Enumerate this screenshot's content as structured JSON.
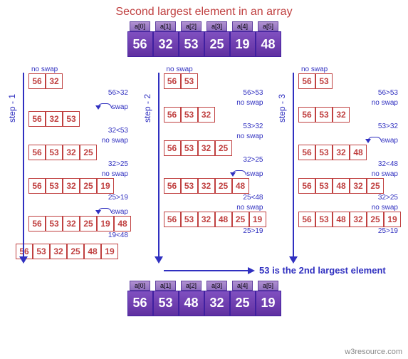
{
  "title": "Second largest element in an array",
  "top_array": {
    "indices": [
      "a[0]",
      "a[1]",
      "a[2]",
      "a[3]",
      "a[4]",
      "a[5]"
    ],
    "values": [
      "56",
      "32",
      "53",
      "25",
      "19",
      "48"
    ]
  },
  "bottom_array": {
    "indices": [
      "a[0]",
      "a[1]",
      "a[2]",
      "a[3]",
      "a[4]",
      "a[5]"
    ],
    "values": [
      "56",
      "53",
      "48",
      "32",
      "25",
      "19"
    ]
  },
  "result_text": "53 is the 2nd largest element",
  "watermark": "w3resource.com",
  "labels": {
    "no_swap": "no swap",
    "swap": "swap"
  },
  "steps": [
    {
      "label": "step - 1",
      "rows": [
        {
          "top": "no swap",
          "top_align": "left",
          "cells": [
            "56",
            "32"
          ],
          "bot": "56>32"
        },
        {
          "top": "swap",
          "top_align": "right",
          "cells": [
            "56",
            "32",
            "53"
          ],
          "bot": "32<53",
          "swap_arc": true
        },
        {
          "top": "no swap",
          "top_align": "right",
          "cells": [
            "56",
            "53",
            "32",
            "25"
          ],
          "bot": "32>25"
        },
        {
          "top": "no swap",
          "top_align": "right",
          "cells": [
            "56",
            "53",
            "32",
            "25",
            "19"
          ],
          "bot": "25>19"
        },
        {
          "top": "swap",
          "top_align": "right",
          "cells": [
            "56",
            "53",
            "32",
            "25",
            "19",
            "48"
          ],
          "bot": "19<48",
          "swap_arc": true
        }
      ],
      "extra_row": [
        "56",
        "53",
        "32",
        "25",
        "48",
        "19"
      ]
    },
    {
      "label": "step - 2",
      "rows": [
        {
          "top": "no swap",
          "top_align": "left",
          "cells": [
            "56",
            "53"
          ],
          "bot": "56>53"
        },
        {
          "top": "no swap",
          "top_align": "right",
          "cells": [
            "56",
            "53",
            "32"
          ],
          "bot": "53>32"
        },
        {
          "top": "no swap",
          "top_align": "right",
          "cells": [
            "56",
            "53",
            "32",
            "25"
          ],
          "bot": "32>25"
        },
        {
          "top": "swap",
          "top_align": "right",
          "cells": [
            "56",
            "53",
            "32",
            "25",
            "48"
          ],
          "bot": "25<48",
          "swap_arc": true
        },
        {
          "top": "no swap",
          "top_align": "right",
          "cells": [
            "56",
            "53",
            "32",
            "48",
            "25",
            "19"
          ],
          "bot": "25>19"
        }
      ]
    },
    {
      "label": "step - 3",
      "rows": [
        {
          "top": "no swap",
          "top_align": "left",
          "cells": [
            "56",
            "53"
          ],
          "bot": "56>53"
        },
        {
          "top": "no swap",
          "top_align": "right",
          "cells": [
            "56",
            "53",
            "32"
          ],
          "bot": "53>32"
        },
        {
          "top": "swap",
          "top_align": "right",
          "cells": [
            "56",
            "53",
            "32",
            "48"
          ],
          "bot": "32<48",
          "swap_arc": true
        },
        {
          "top": "no swap",
          "top_align": "right",
          "cells": [
            "56",
            "53",
            "48",
            "32",
            "25"
          ],
          "bot": "32>25"
        },
        {
          "top": "no swap",
          "top_align": "right",
          "cells": [
            "56",
            "53",
            "48",
            "32",
            "25",
            "19"
          ],
          "bot": "25>19"
        }
      ]
    }
  ]
}
